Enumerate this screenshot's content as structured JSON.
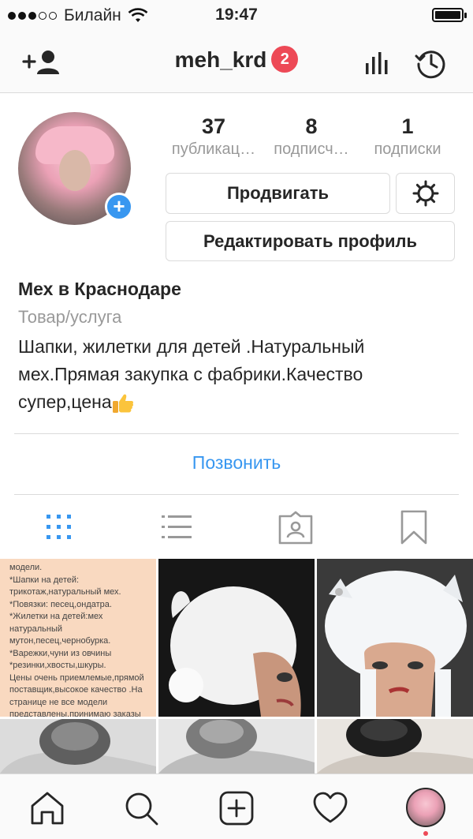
{
  "status_bar": {
    "carrier": "Билайн",
    "time": "19:47"
  },
  "header": {
    "username": "meh_krd",
    "notification_count": "2"
  },
  "profile": {
    "stats": [
      {
        "value": "37",
        "label": "публикац…"
      },
      {
        "value": "8",
        "label": "подписч…"
      },
      {
        "value": "1",
        "label": "подписки"
      }
    ],
    "promote_label": "Продвигать",
    "edit_label": "Редактировать профиль"
  },
  "bio": {
    "name": "Мех в Краснодаре",
    "category": "Товар/услуга",
    "line1": "Шапки, жилетки для детей .Натуральный",
    "line2": "мех.Прямая закупка с фабрики.Качество",
    "line3": "супер,цена"
  },
  "contact": {
    "call_label": "Позвонить"
  },
  "posts": {
    "first_post_text": [
      "модели.",
      "*Шапки на детей:",
      "трикотаж,натуральный мех.",
      "*Повязки: песец,ондатра.",
      "*Жилетки на детей:мех",
      "натуральный",
      "мутон,песец,чернобурка.",
      "*Варежки,чуни из овчины",
      "*резинки,хвосты,шкуры.",
      "Цены очень приемлемые,прямой",
      "поставщик,высокое качество .На",
      "странице не все модели",
      "представлены,принимаю заказы"
    ]
  },
  "colors": {
    "accent": "#3897f0",
    "badge": "#ed4956"
  },
  "icons": {
    "header": [
      "add-person-icon",
      "insights-icon",
      "archive-icon"
    ],
    "tabs": [
      "grid-icon",
      "list-icon",
      "tagged-icon",
      "saved-icon"
    ],
    "bottom": [
      "home-icon",
      "search-icon",
      "add-post-icon",
      "heart-icon",
      "profile-avatar"
    ]
  }
}
